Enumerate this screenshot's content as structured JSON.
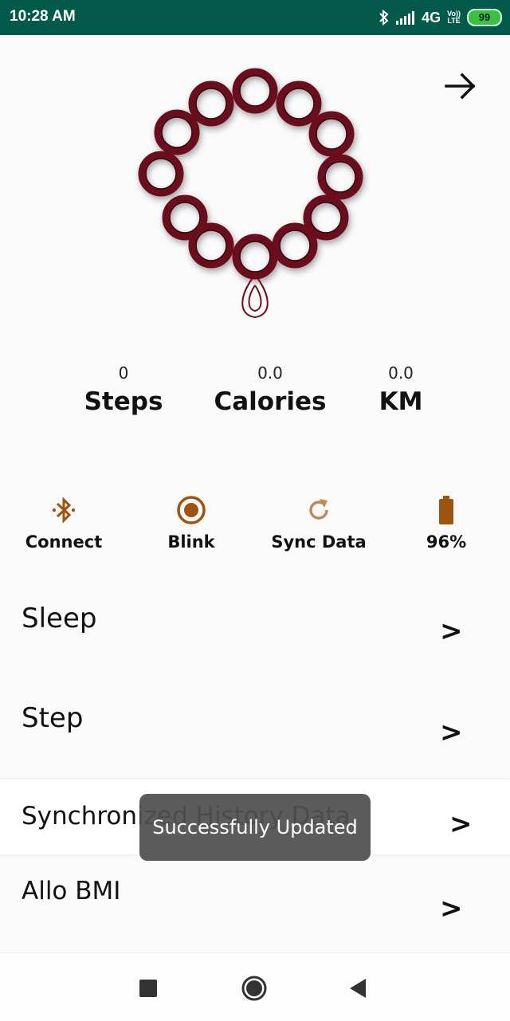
{
  "status_bar": {
    "time": "10:28 AM",
    "network": "4G",
    "volte": [
      "Vo))",
      "LTE"
    ],
    "battery": "99"
  },
  "stats": [
    {
      "value": "0",
      "label": "Steps"
    },
    {
      "value": "0.0",
      "label": "Calories"
    },
    {
      "value": "0.0",
      "label": "KM"
    }
  ],
  "actions": [
    {
      "label": "Connect",
      "icon": "bluetooth-icon"
    },
    {
      "label": "Blink",
      "icon": "radio-target-icon"
    },
    {
      "label": "Sync Data",
      "icon": "refresh-icon"
    },
    {
      "label": "96%",
      "icon": "battery-icon"
    }
  ],
  "menu": [
    {
      "title": "Sleep",
      "chevron": ">"
    },
    {
      "title": "Step",
      "chevron": ">"
    },
    {
      "title": "Synchronized History Data",
      "chevron": ">"
    },
    {
      "title": "Allo BMI",
      "chevron": ">"
    }
  ],
  "toast": "Successfully Updated",
  "colors": {
    "status_bar": "#035a4a",
    "accent": "#a0520f",
    "bead": "#6b0f1f"
  }
}
